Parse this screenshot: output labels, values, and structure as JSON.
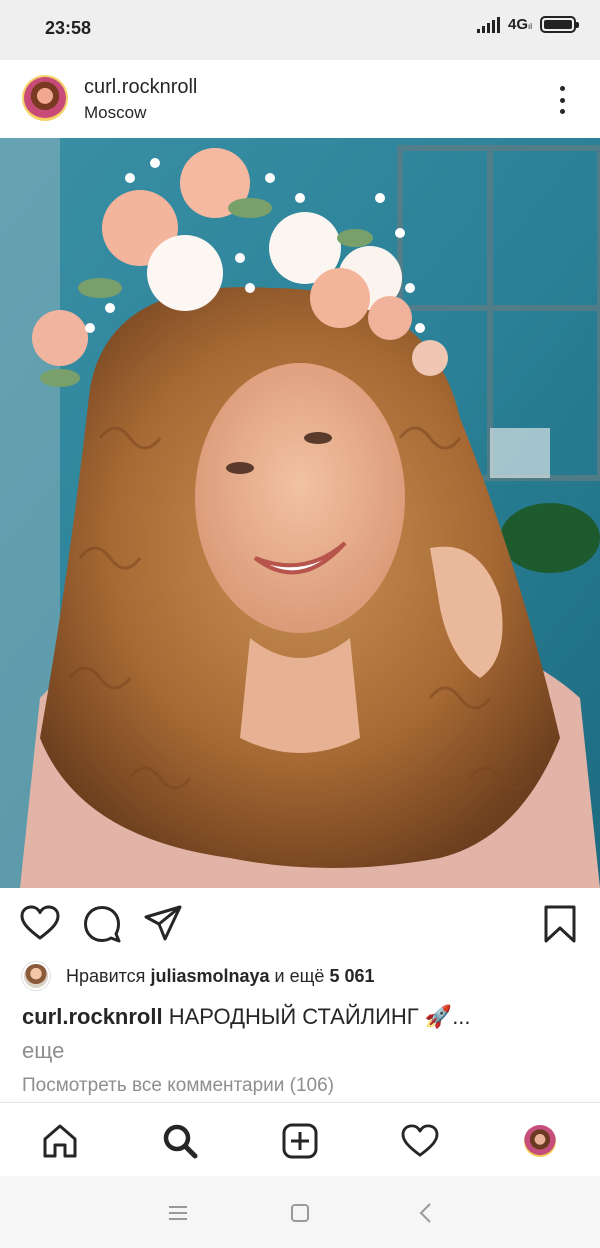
{
  "status_bar": {
    "time": "23:58",
    "network": "4G",
    "network_sub": "ıl",
    "battery_level": 1.0
  },
  "post": {
    "username": "curl.rocknroll",
    "location": "Moscow",
    "photo_icon": "selfie-photo"
  },
  "actions": {
    "like_icon": "heart-icon",
    "comment_icon": "comment-icon",
    "share_icon": "paper-plane-icon",
    "save_icon": "bookmark-icon"
  },
  "likes": {
    "prefix": "Нравится",
    "user": "juliasmolnaya",
    "middle": "и ещё",
    "count": "5 061"
  },
  "caption": {
    "user": "curl.rocknroll",
    "text": "НАРОДНЫЙ СТАЙЛИНГ 🚀...",
    "more": "еще"
  },
  "comments_link": "Посмотреть все комментарии (106)",
  "bottom_nav": [
    "home-icon",
    "search-icon",
    "add-post-icon",
    "activity-heart-icon",
    "profile-avatar"
  ],
  "system_nav": [
    "menu-icon",
    "home-square-icon",
    "back-icon"
  ],
  "colors": {
    "text": "#262626",
    "muted": "#8e8e8e",
    "status_bg": "#efefef",
    "photo_wall": "#2a7f93"
  }
}
